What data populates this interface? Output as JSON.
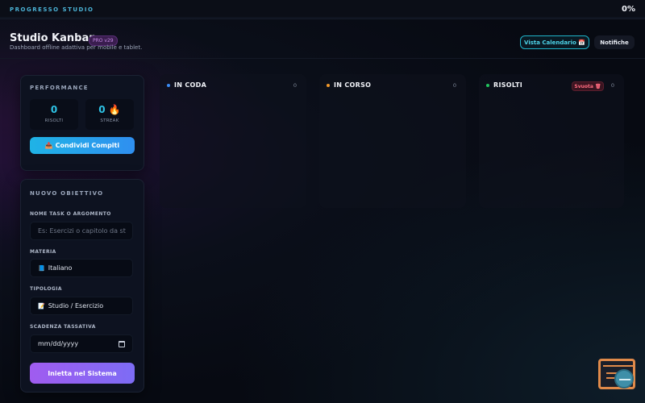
{
  "topbar": {
    "label": "PROGRESSO STUDIO",
    "percent_text": "0%",
    "progress": 0
  },
  "header": {
    "title": "Studio Kanban",
    "badge": "PRO v29",
    "subtitle": "Dashboard offline adattiva per mobile e tablet.",
    "calendar_button": "Vista Calendario 📅",
    "notifications_button": "Notifiche"
  },
  "performance": {
    "title": "PERFORMANCE",
    "stats": [
      {
        "value": "0",
        "caption": "RISOLTI"
      },
      {
        "value": "0 🔥",
        "caption": "STREAK"
      }
    ],
    "share_button": "📤 Condividi Compiti"
  },
  "new_goal": {
    "title": "NUOVO OBIETTIVO",
    "task_label": "NOME TASK O ARGOMENTO",
    "task_placeholder": "Es: Esercizi o capitolo da st",
    "subject_label": "MATERIA",
    "subject_icon": "📘",
    "subject_value": "Italiano",
    "type_label": "TIPOLOGIA",
    "type_icon": "📝",
    "type_value": "Studio / Esercizio",
    "deadline_label": "SCADENZA TASSATIVA",
    "deadline_placeholder": "mm/dd/yyyy",
    "submit_button": "Inietta nel Sistema"
  },
  "columns": [
    {
      "title": "IN CODA",
      "count": "0",
      "dot_color": "#3b8cf5"
    },
    {
      "title": "IN CORSO",
      "count": "0",
      "dot_color": "#f59a2a"
    },
    {
      "title": "RISOLTI",
      "count": "0",
      "dot_color": "#22c55e",
      "clear_button": "Svuota 🗑"
    }
  ],
  "colors": {
    "accent_cyan": "#22c1e6",
    "accent_purple": "#a05cf0",
    "danger": "#ff6b7f"
  },
  "widget": {
    "icon": "code-inspector-icon"
  }
}
